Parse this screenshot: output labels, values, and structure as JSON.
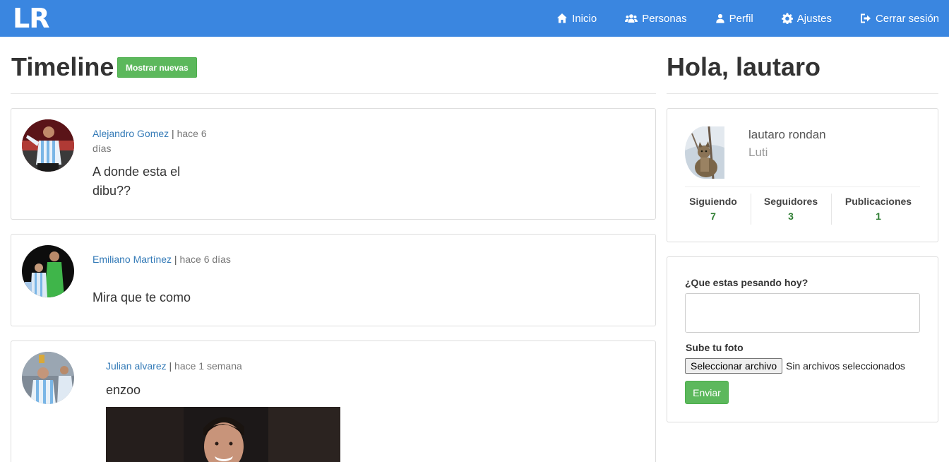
{
  "navbar": {
    "brand": "LR",
    "items": [
      {
        "label": "Inicio",
        "icon": "home-icon"
      },
      {
        "label": "Personas",
        "icon": "users-icon"
      },
      {
        "label": "Perfil",
        "icon": "user-icon"
      },
      {
        "label": "Ajustes",
        "icon": "gear-icon"
      },
      {
        "label": "Cerrar sesión",
        "icon": "logout-icon"
      }
    ],
    "color": "#3a86e0"
  },
  "timeline": {
    "title": "Timeline",
    "new_button": "Mostrar nuevas",
    "posts": [
      {
        "author": "Alejandro Gomez",
        "separator": " | ",
        "time": "hace 6 días",
        "text": "A donde esta el dibu??"
      },
      {
        "author": "Emiliano Martínez",
        "separator": " | ",
        "time": "hace 6 días",
        "text": "Mira que te como"
      },
      {
        "author": "Julian alvarez",
        "separator": " | ",
        "time": "hace 1 semana",
        "text": "enzoo"
      }
    ]
  },
  "sidebar": {
    "greeting": "Hola, lautaro",
    "profile": {
      "name": "lautaro rondan",
      "nick": "Luti",
      "stats": [
        {
          "label": "Siguiendo",
          "value": "7"
        },
        {
          "label": "Seguidores",
          "value": "3"
        },
        {
          "label": "Publicaciones",
          "value": "1"
        }
      ]
    },
    "form": {
      "prompt": "¿Que estas pesando hoy?",
      "textarea_value": "",
      "photo_label": "Sube tu foto",
      "file_button": "Seleccionar archivo",
      "file_status": "Sin archivos seleccionados",
      "submit": "Enviar"
    }
  },
  "colors": {
    "accent": "#3a86e0",
    "success": "#5cb85c",
    "link": "#337ab7",
    "stat": "#2e7d32"
  }
}
